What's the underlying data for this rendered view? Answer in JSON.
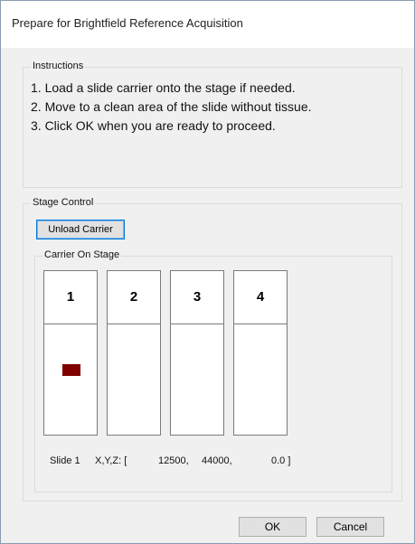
{
  "dialog": {
    "title": "Prepare for Brightfield Reference Acquisition"
  },
  "instructions": {
    "label": "Instructions",
    "lines": [
      "1. Load a slide carrier onto the stage if needed.",
      "2. Move to a clean area of the slide without tissue.",
      "3. Click OK when you are ready to proceed."
    ]
  },
  "stage_control": {
    "label": "Stage Control",
    "unload_button": "Unload Carrier",
    "carrier": {
      "label": "Carrier On Stage",
      "slots": [
        {
          "number": "1",
          "has_slide": true
        },
        {
          "number": "2",
          "has_slide": false
        },
        {
          "number": "3",
          "has_slide": false
        },
        {
          "number": "4",
          "has_slide": false
        }
      ],
      "slide_color": "#800000",
      "status": {
        "slide": "Slide 1",
        "xyz_label": "X,Y,Z: [",
        "x": "12500,",
        "y": "44000,",
        "z": "0.0 ]"
      }
    }
  },
  "buttons": {
    "ok": "OK",
    "cancel": "Cancel"
  },
  "colors": {
    "focus_border": "#0078d7",
    "window_bg": "#f0f0f0"
  }
}
